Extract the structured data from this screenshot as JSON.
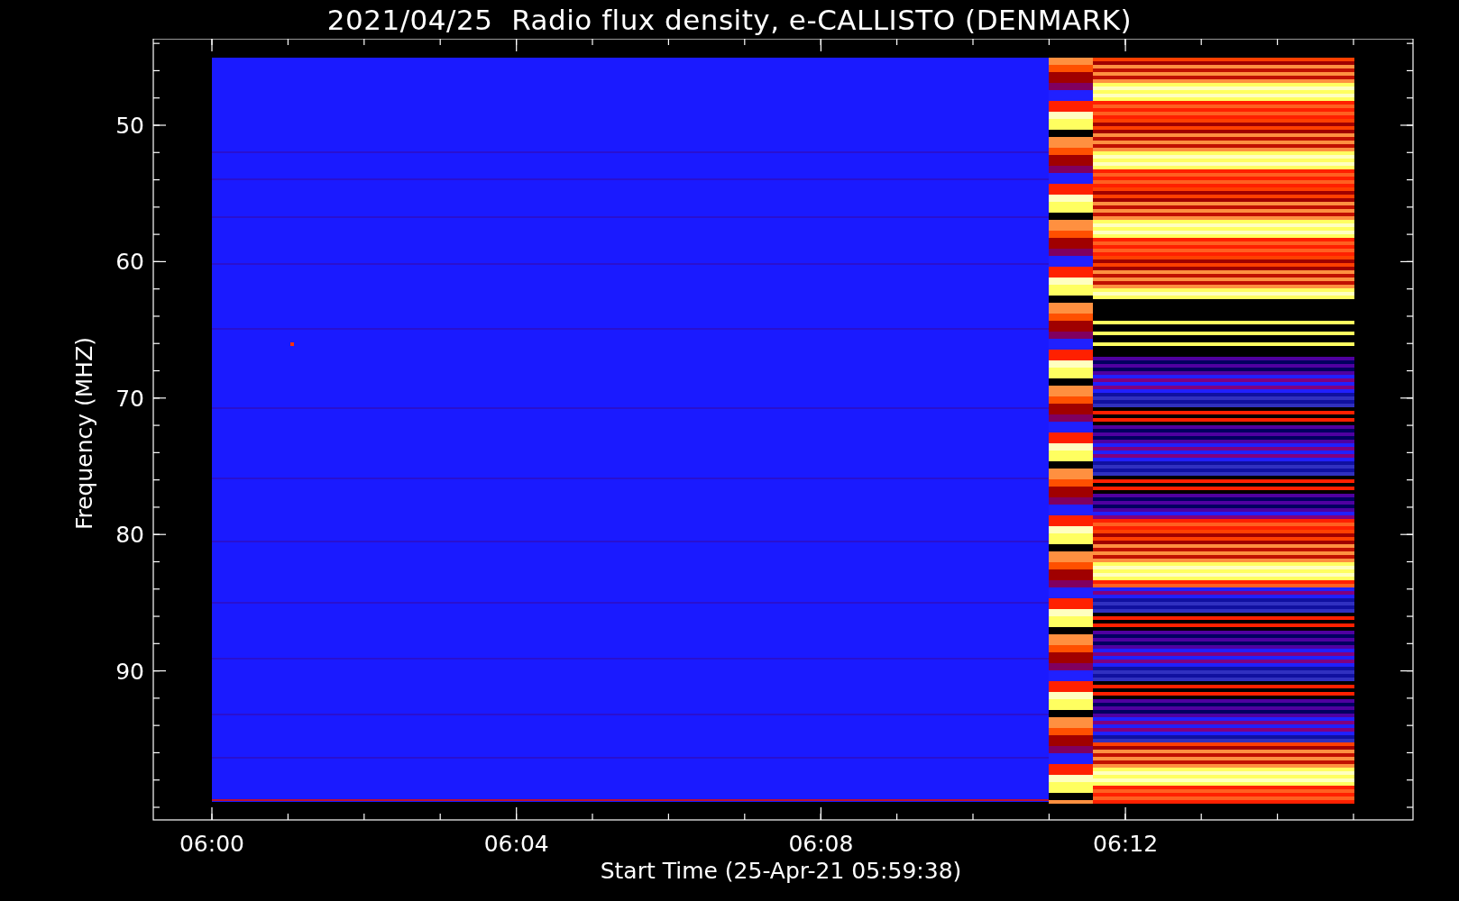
{
  "title": "2021/04/25  Radio flux density, e-CALLISTO (DENMARK)",
  "y_axis": {
    "label": "Frequency (MHZ)",
    "ticks": [
      "50",
      "60",
      "70",
      "80",
      "90"
    ]
  },
  "x_axis": {
    "label": "Start Time (25-Apr-21 05:59:38)",
    "ticks": [
      "06:00",
      "06:04",
      "06:08",
      "06:12"
    ]
  }
}
